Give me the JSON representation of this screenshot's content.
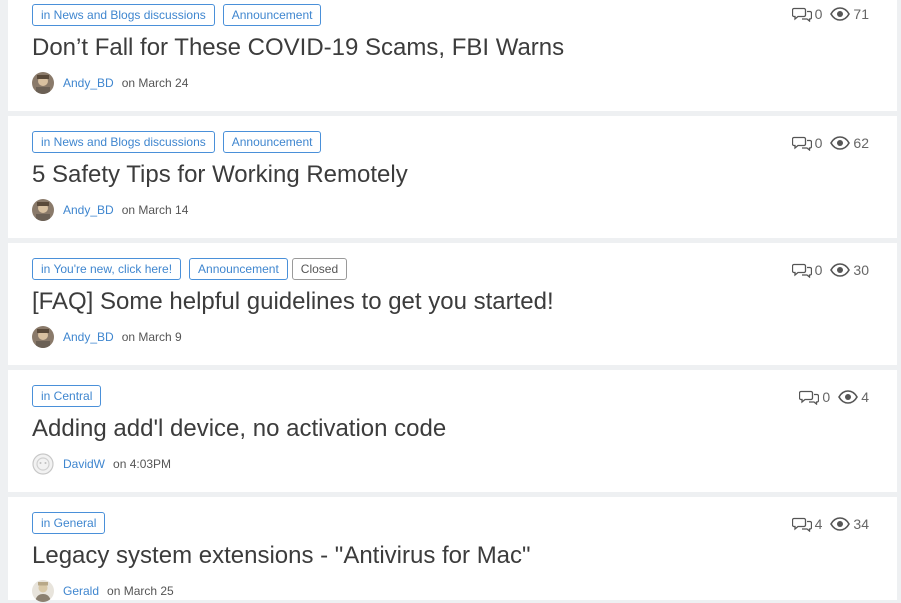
{
  "posts": [
    {
      "tags": [
        "in News and Blogs discussions",
        "Announcement"
      ],
      "title": "Don’t Fall for These COVID-19 Scams, FBI Warns",
      "author": "Andy_BD",
      "date": "on March 24",
      "comments": "0",
      "views": "71"
    },
    {
      "tags": [
        "in News and Blogs discussions",
        "Announcement"
      ],
      "title": "5 Safety Tips for Working Remotely",
      "author": "Andy_BD",
      "date": "on March 14",
      "comments": "0",
      "views": "62"
    },
    {
      "tags": [
        "in You're new, click here!",
        "Announcement"
      ],
      "status": "Closed",
      "title": "[FAQ] Some helpful guidelines to get you started!",
      "author": "Andy_BD",
      "date": "on March 9",
      "comments": "0",
      "views": "30"
    },
    {
      "tags": [
        "in Central"
      ],
      "title": "Adding add'l device, no activation code",
      "author": "DavidW",
      "date": "on 4:03PM",
      "comments": "0",
      "views": "4"
    },
    {
      "tags": [
        "in General"
      ],
      "title": "Legacy system extensions - \"Antivirus for Mac\"",
      "author": "Gerald",
      "date": "on March 25",
      "comments": "4",
      "views": "34"
    }
  ],
  "icons": {
    "comments": "comment-bubbles-icon",
    "views": "eye-icon"
  },
  "colors": {
    "link": "#3f86cf",
    "tag_border": "#4a90d9",
    "title": "#3c3c3c",
    "background": "#eef0f2",
    "card": "#ffffff"
  }
}
